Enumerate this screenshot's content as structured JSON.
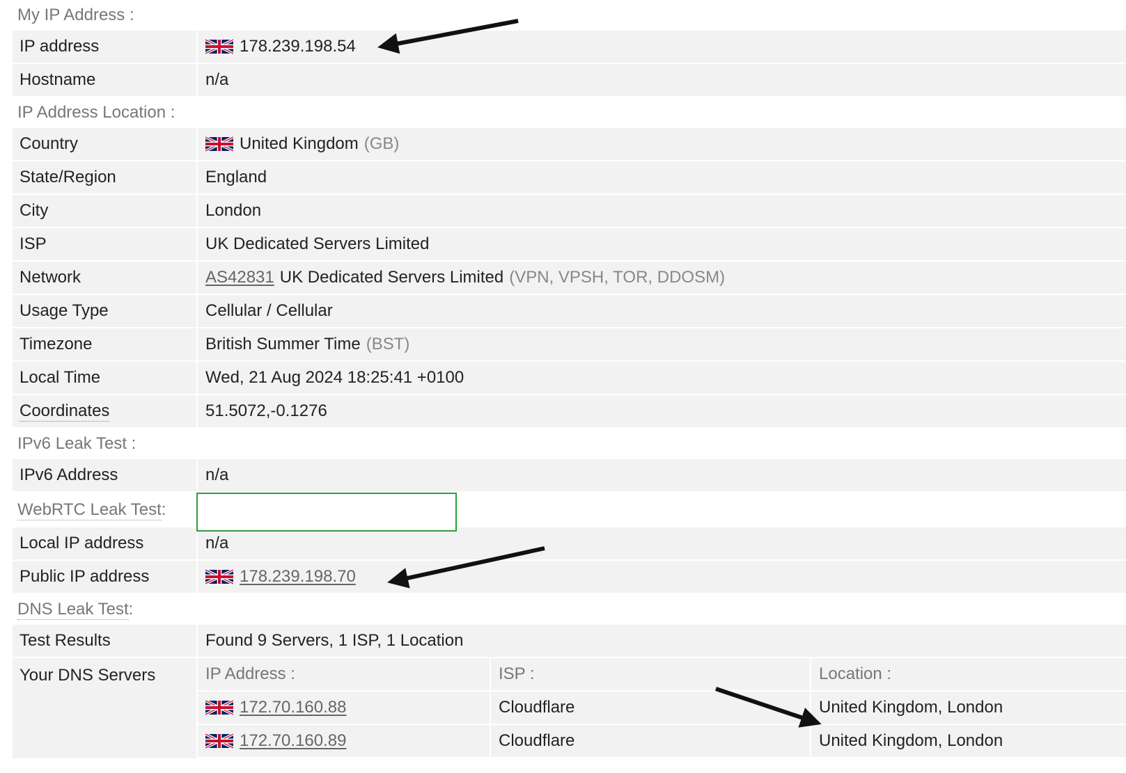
{
  "sections": {
    "my_ip": "My IP Address :",
    "location": "IP Address Location :",
    "ipv6": "IPv6 Leak Test :",
    "webrtc": "WebRTC Leak Test",
    "webrtc_colon": " :",
    "dns": "DNS Leak Test",
    "dns_colon": " :"
  },
  "my_ip": {
    "ip_label": "IP address",
    "ip_value": "178.239.198.54",
    "hostname_label": "Hostname",
    "hostname_value": "n/a"
  },
  "location": {
    "country_label": "Country",
    "country_value": "United Kingdom",
    "country_code": "(GB)",
    "state_label": "State/Region",
    "state_value": "England",
    "city_label": "City",
    "city_value": "London",
    "isp_label": "ISP",
    "isp_value": "UK Dedicated Servers Limited",
    "network_label": "Network",
    "network_asn": "AS42831",
    "network_value": "UK Dedicated Servers Limited",
    "network_tags": "(VPN, VPSH, TOR, DDOSM)",
    "usage_label": "Usage Type",
    "usage_value": "Cellular / Cellular",
    "timezone_label": "Timezone",
    "timezone_value": "British Summer Time",
    "timezone_code": "(BST)",
    "localtime_label": "Local Time",
    "localtime_value": "Wed, 21 Aug 2024 18:25:41 +0100",
    "coords_label": "Coordinates",
    "coords_value": "51.5072,-0.1276"
  },
  "ipv6": {
    "address_label": "IPv6 Address",
    "address_value": "n/a"
  },
  "webrtc": {
    "local_label": "Local IP address",
    "local_value": "n/a",
    "public_label": "Public IP address",
    "public_value": "178.239.198.70"
  },
  "dns": {
    "results_label": "Test Results",
    "results_value": "Found 9 Servers, 1 ISP, 1 Location",
    "servers_label": "Your DNS Servers",
    "col_ip": "IP Address :",
    "col_isp": "ISP :",
    "col_location": "Location :",
    "rows": [
      {
        "ip": "172.70.160.88",
        "isp": "Cloudflare",
        "location": "United Kingdom, London"
      },
      {
        "ip": "172.70.160.89",
        "isp": "Cloudflare",
        "location": "United Kingdom, London"
      }
    ]
  },
  "colors": {
    "row_bg": "#f2f2f2",
    "muted": "#777777",
    "webrtc_border": "#2e9c3a"
  },
  "icons": {
    "flag": "uk-flag-icon",
    "arrow": "annotation-arrow"
  }
}
